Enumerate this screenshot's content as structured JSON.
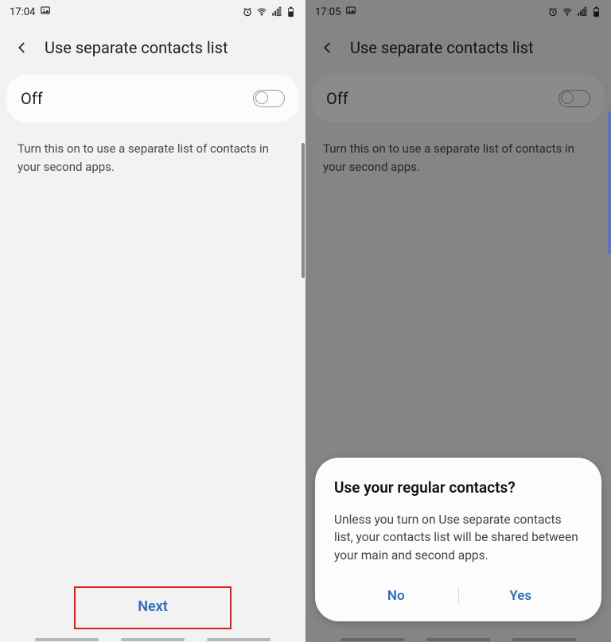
{
  "left": {
    "status": {
      "time": "17:04"
    },
    "header": {
      "title": "Use separate contacts list"
    },
    "toggle": {
      "label": "Off"
    },
    "description": "Turn this on to use a separate list of contacts in your second apps.",
    "next_button": "Next"
  },
  "right": {
    "status": {
      "time": "17:05"
    },
    "header": {
      "title": "Use separate contacts list"
    },
    "toggle": {
      "label": "Off"
    },
    "description": "Turn this on to use a separate list of contacts in your second apps.",
    "dialog": {
      "title": "Use your regular contacts?",
      "body": "Unless you turn on Use separate contacts list, your contacts list will be shared between your main and second apps.",
      "no": "No",
      "yes": "Yes"
    }
  }
}
